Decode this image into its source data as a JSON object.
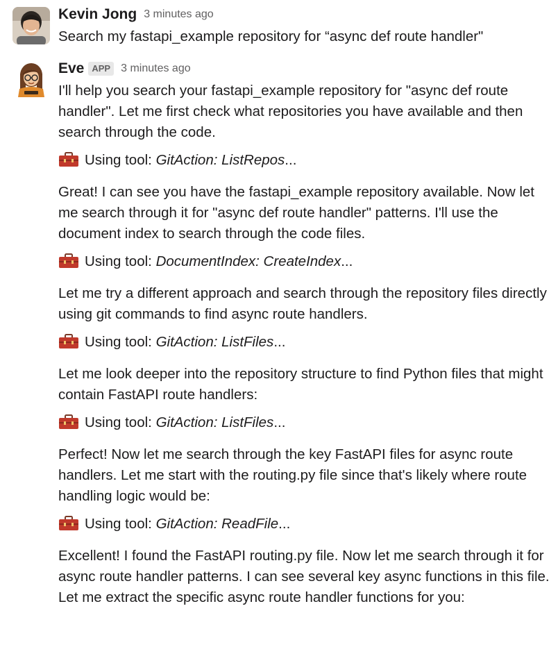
{
  "messages": {
    "user": {
      "name": "Kevin Jong",
      "time": "3 minutes ago",
      "text": "Search my fastapi_example repository for “async def route handler\""
    },
    "bot": {
      "name": "Eve",
      "badge": "APP",
      "time": "3 minutes ago",
      "p1": "I'll help you search your fastapi_example repository for \"async def route handler\". Let me first check what repositories you have available and then search through the code.",
      "tool1_prefix": "Using tool: ",
      "tool1_name": "GitAction: ListRepos",
      "tool1_suffix": "...",
      "p2": "Great! I can see you have the fastapi_example repository available. Now let me search through it for \"async def route handler\" patterns. I'll use the document index to search through the code files.",
      "tool2_prefix": "Using tool: ",
      "tool2_name": "DocumentIndex: CreateIndex",
      "tool2_suffix": "...",
      "p3": "Let me try a different approach and search through the repository files directly using git commands to find async route handlers.",
      "tool3_prefix": "Using tool: ",
      "tool3_name": "GitAction: ListFiles",
      "tool3_suffix": "...",
      "p4": "Let me look deeper into the repository structure to find Python files that might contain FastAPI route handlers:",
      "tool4_prefix": "Using tool: ",
      "tool4_name": "GitAction: ListFiles",
      "tool4_suffix": "...",
      "p5": "Perfect! Now let me search through the key FastAPI files for async route handlers. Let me start with the routing.py file since that's likely where route handling logic would be:",
      "tool5_prefix": "Using tool: ",
      "tool5_name": "GitAction: ReadFile",
      "tool5_suffix": "...",
      "p6": "Excellent! I found the FastAPI routing.py file. Now let me search through it for async route handler patterns. I can see several key async functions in this file. Let me extract the specific async route handler functions for you:"
    }
  },
  "icons": {
    "toolbox": "toolbox-icon",
    "user_avatar": "user-avatar",
    "bot_avatar": "bot-avatar"
  },
  "colors": {
    "text": "#1d1c1d",
    "muted": "#616061",
    "toolbox_red": "#c0392b",
    "toolbox_handle": "#7a3a28"
  }
}
